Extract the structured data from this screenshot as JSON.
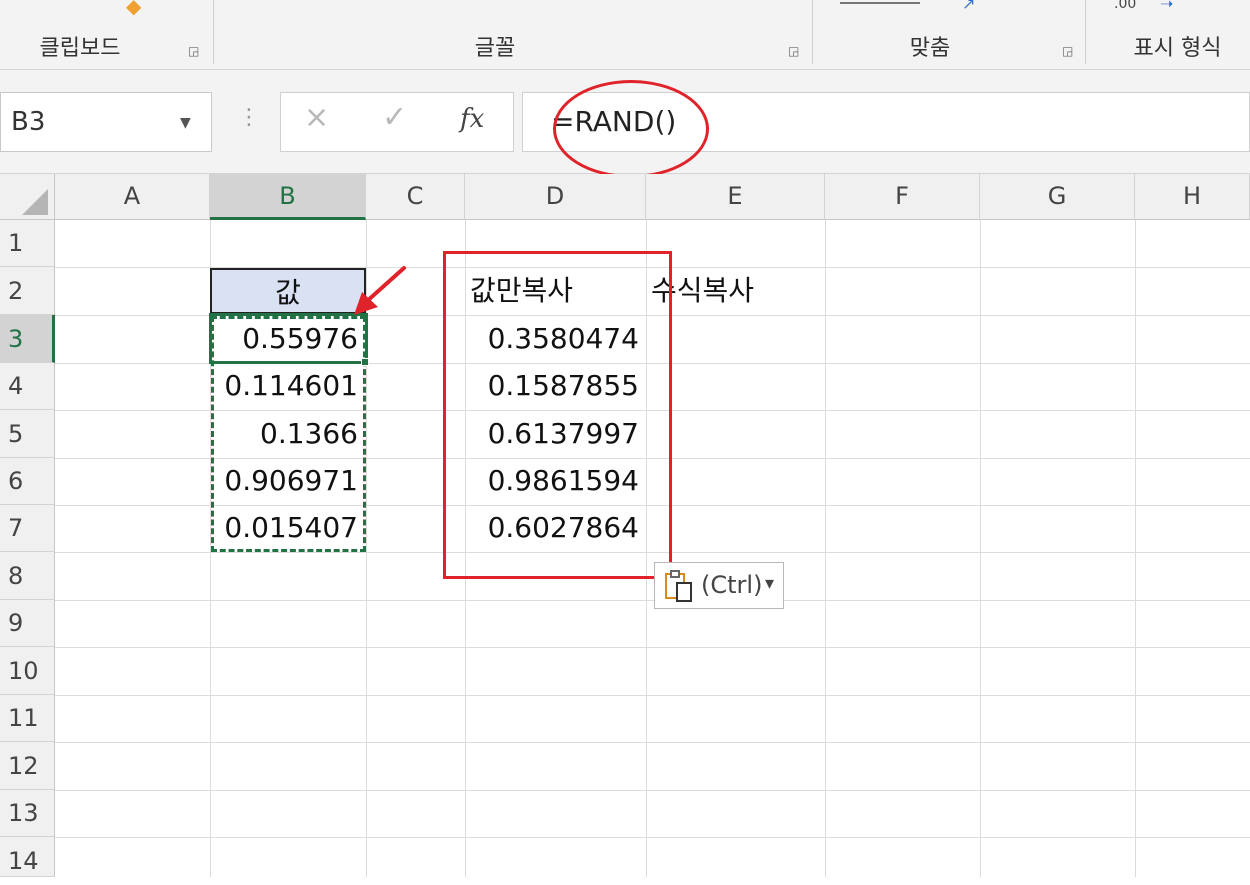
{
  "ribbon": {
    "groups": [
      "클립보드",
      "글꼴",
      "맞춤",
      "표시 형식"
    ],
    "number_format_hint": ".00"
  },
  "formula_bar": {
    "name_box": "B3",
    "cancel_icon": "×",
    "enter_icon": "✓",
    "fx_label": "fx",
    "formula": "=RAND()"
  },
  "columns": [
    "A",
    "B",
    "C",
    "D",
    "E",
    "F",
    "G",
    "H"
  ],
  "rows": [
    "1",
    "2",
    "3",
    "4",
    "5",
    "6",
    "7",
    "8",
    "9",
    "10",
    "11",
    "12",
    "13",
    "14"
  ],
  "sheet": {
    "B2": "값",
    "D2": "값만복사",
    "E2": "수식복사",
    "B_values": [
      "0.55976",
      "0.114601",
      "0.1366",
      "0.906971",
      "0.015407"
    ],
    "D_values": [
      "0.3580474",
      "0.1587855",
      "0.6137997",
      "0.9861594",
      "0.6027864"
    ]
  },
  "paste_options": {
    "label": "(Ctrl)",
    "arrow": "▾"
  },
  "colors": {
    "accent_green": "#217346",
    "annotation_red": "#e0232a",
    "header_fill": "#d9e1f2"
  }
}
